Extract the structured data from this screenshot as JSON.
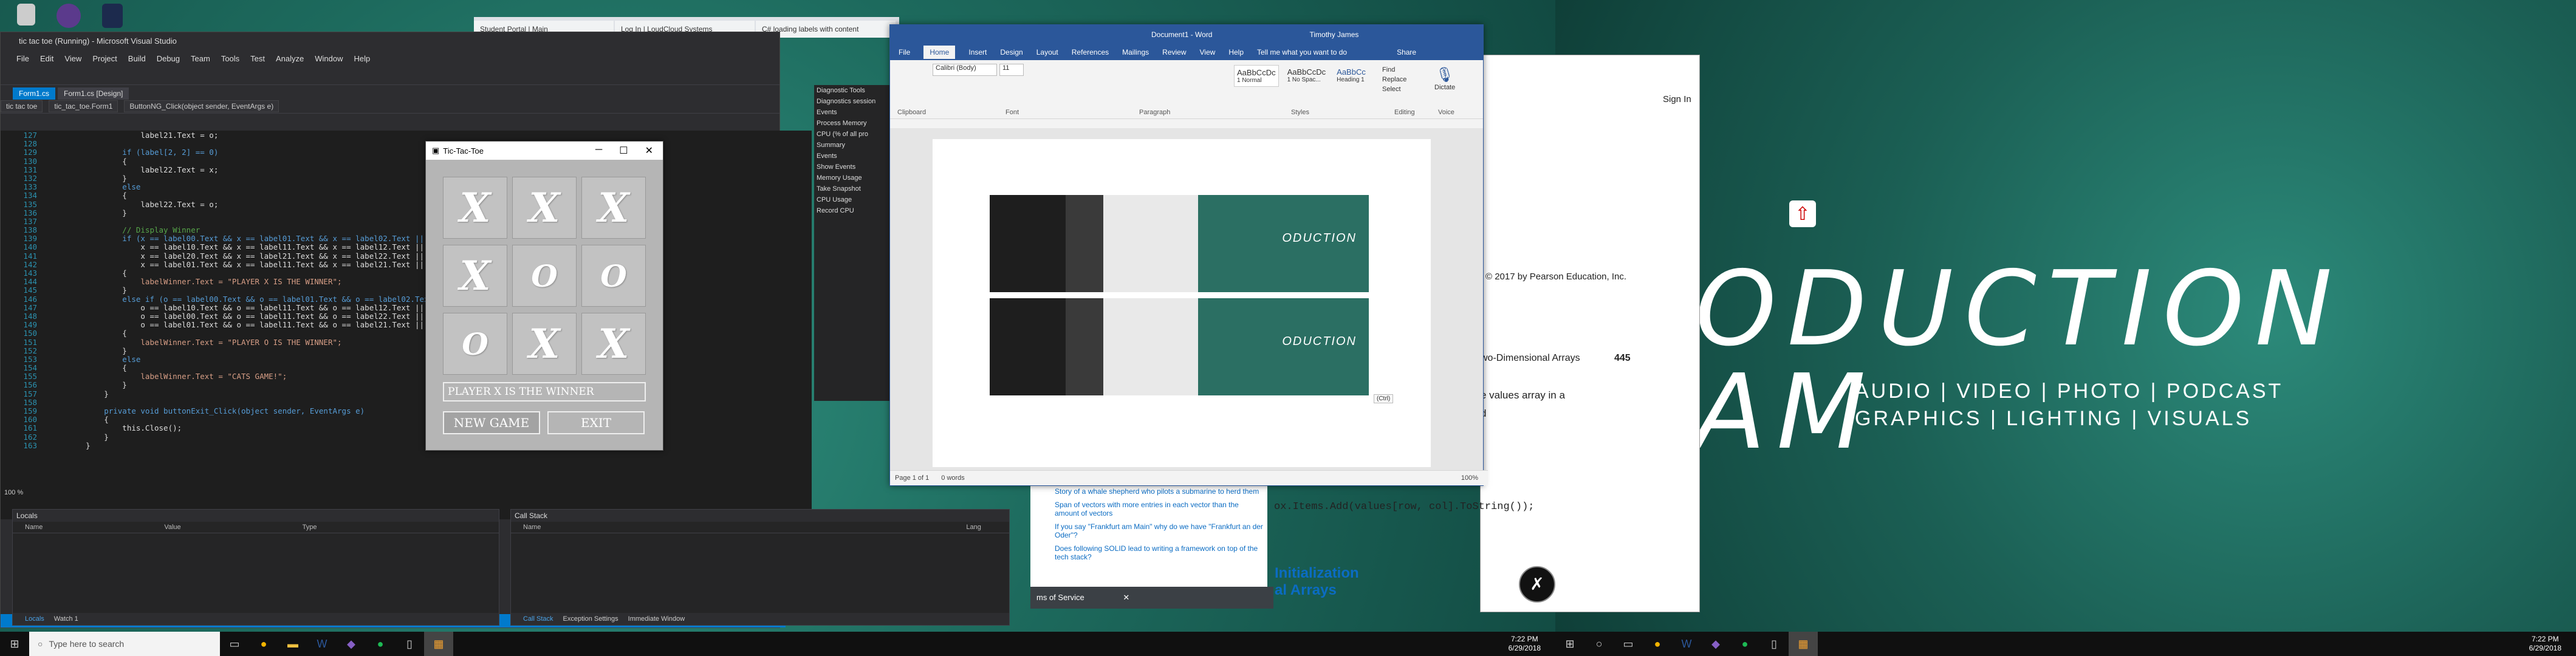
{
  "vs": {
    "title": "tic tac toe (Running) - Microsoft Visual Studio",
    "menu": [
      "File",
      "Edit",
      "View",
      "Project",
      "Build",
      "Debug",
      "Team",
      "Tools",
      "Test",
      "Analyze",
      "Window",
      "Help"
    ],
    "tabs": [
      "Form1.cs",
      "Form1.cs [Design]"
    ],
    "nav": [
      "tic tac toe",
      "tic_tac_toe.Form1",
      "ButtonNG_Click(object sender, EventArgs e)"
    ],
    "code": [
      [
        "127",
        "                label21.Text = o;"
      ],
      [
        "128",
        ""
      ],
      [
        "129",
        "            if (label[2, 2] == 0)"
      ],
      [
        "130",
        "            {"
      ],
      [
        "131",
        "                label22.Text = x;"
      ],
      [
        "132",
        "            }"
      ],
      [
        "133",
        "            else"
      ],
      [
        "134",
        "            {"
      ],
      [
        "135",
        "                label22.Text = o;"
      ],
      [
        "136",
        "            }"
      ],
      [
        "137",
        ""
      ],
      [
        "138",
        "            // Display Winner"
      ],
      [
        "139",
        "            if (x == label00.Text && x == label01.Text && x == label02.Text || x =="
      ],
      [
        "140",
        "                x == label10.Text && x == label11.Text && x == label12.Text || x =="
      ],
      [
        "141",
        "                x == label20.Text && x == label21.Text && x == label22.Text || x =="
      ],
      [
        "142",
        "                x == label01.Text && x == label11.Text && x == label21.Text || x =="
      ],
      [
        "143",
        "            {"
      ],
      [
        "144",
        "                labelWinner.Text = \"PLAYER X IS THE WINNER\";"
      ],
      [
        "145",
        "            }"
      ],
      [
        "146",
        "            else if (o == label00.Text && o == label01.Text && o == label02.Text ||"
      ],
      [
        "147",
        "                o == label10.Text && o == label11.Text && o == label12.Text || o =="
      ],
      [
        "148",
        "                o == label00.Text && o == label11.Text && o == label22.Text || o =="
      ],
      [
        "149",
        "                o == label01.Text && o == label11.Text && o == label21.Text || o =="
      ],
      [
        "150",
        "            {"
      ],
      [
        "151",
        "                labelWinner.Text = \"PLAYER O IS THE WINNER\";"
      ],
      [
        "152",
        "            }"
      ],
      [
        "153",
        "            else"
      ],
      [
        "154",
        "            {"
      ],
      [
        "155",
        "                labelWinner.Text = \"CATS GAME!\";"
      ],
      [
        "156",
        "            }"
      ],
      [
        "157",
        "        }"
      ],
      [
        "158",
        ""
      ],
      [
        "159",
        "        private void buttonExit_Click(object sender, EventArgs e)"
      ],
      [
        "160",
        "        {"
      ],
      [
        "161",
        "            this.Close();"
      ],
      [
        "162",
        "        }"
      ],
      [
        "163",
        "    }"
      ]
    ],
    "zoom": "100 %",
    "diag": [
      "Diagnostic Tools",
      "Diagnostics session",
      "Events",
      "Process Memory",
      "CPU (% of all pro",
      "Summary",
      "Events",
      "Show Events",
      "Memory Usage",
      "Take Snapshot",
      "CPU Usage",
      "Record CPU"
    ],
    "locals": {
      "title": "Locals",
      "cols": [
        "Name",
        "Value",
        "Type"
      ],
      "tabs": [
        "Locals",
        "Watch 1"
      ]
    },
    "callstack": {
      "title": "Call Stack",
      "cols": [
        "Name",
        "Lang"
      ],
      "tabs": [
        "Call Stack",
        "Exception Settings",
        "Immediate Window"
      ]
    }
  },
  "ttt": {
    "title": "Tic-Tac-Toe",
    "cells": [
      "X",
      "X",
      "X",
      "X",
      "O",
      "O",
      "O",
      "X",
      "X"
    ],
    "winner": "PLAYER X IS THE WINNER",
    "new_game": "NEW GAME",
    "exit": "EXIT"
  },
  "chrome": {
    "tabs": [
      "Student Portal | Main",
      "Log In | LoudCloud Systems",
      "C# loading labels with content"
    ]
  },
  "word": {
    "title": "Document1 - Word",
    "user": "Timothy James",
    "tabs": [
      "File",
      "Home",
      "Insert",
      "Design",
      "Layout",
      "References",
      "Mailings",
      "Review",
      "View",
      "Help"
    ],
    "tell": "Tell me what you want to do",
    "share": "Share",
    "groups": [
      "Clipboard",
      "Font",
      "Paragraph",
      "Styles",
      "Editing",
      "Voice"
    ],
    "font": "Calibri (Body)",
    "size": "11",
    "styles": [
      "AaBbCcDc",
      "AaBbCcDc",
      "AaBbCc"
    ],
    "style_names": [
      "1 Normal",
      "1 No Spac...",
      "Heading 1"
    ],
    "editing": [
      "Find",
      "Replace",
      "Select"
    ],
    "dictate": "Dictate",
    "shot_text": "ODUCTION\nAM",
    "paste_tag": "(Ctrl)",
    "status": [
      "Page 1 of 1",
      "0 words"
    ],
    "zoom": "100%"
  },
  "book": {
    "signin": "Sign In",
    "copyright": "© 2017 by Pearson Education, Inc.",
    "section": "wo-Dimensional Arrays",
    "page": "445",
    "line1": "e values array in a",
    "line2": "d",
    "code": "ox.Items.Add(values[row, col].ToString());",
    "init1": "Initialization",
    "init2": "al Arrays"
  },
  "so": {
    "questions": [
      "Story of a whale shepherd who pilots a submarine to herd them",
      "Span of vectors with more entries in each vector than the amount of vectors",
      "If you say \"Frankfurt am Main\" why do we have \"Frankfurt an der Oder\"?",
      "Does following SOLID lead to writing a framework on top of the tech stack?"
    ],
    "tos": "ms of Service"
  },
  "wall": {
    "big1": "ODUCTION",
    "big2": "AM",
    "promo1": "AUDIO | VIDEO | PHOTO | PODCAST",
    "promo2": "GRAPHICS  |  LIGHTING  |  VISUALS"
  },
  "taskbar": {
    "search": "Type here to search",
    "time_left": "7:22 PM",
    "date_left": "6/29/2018",
    "time_right": "7:22 PM",
    "date_right": "6/29/2018"
  },
  "colors": {
    "vs_blue": "#007acc",
    "word_blue": "#2b579a"
  }
}
